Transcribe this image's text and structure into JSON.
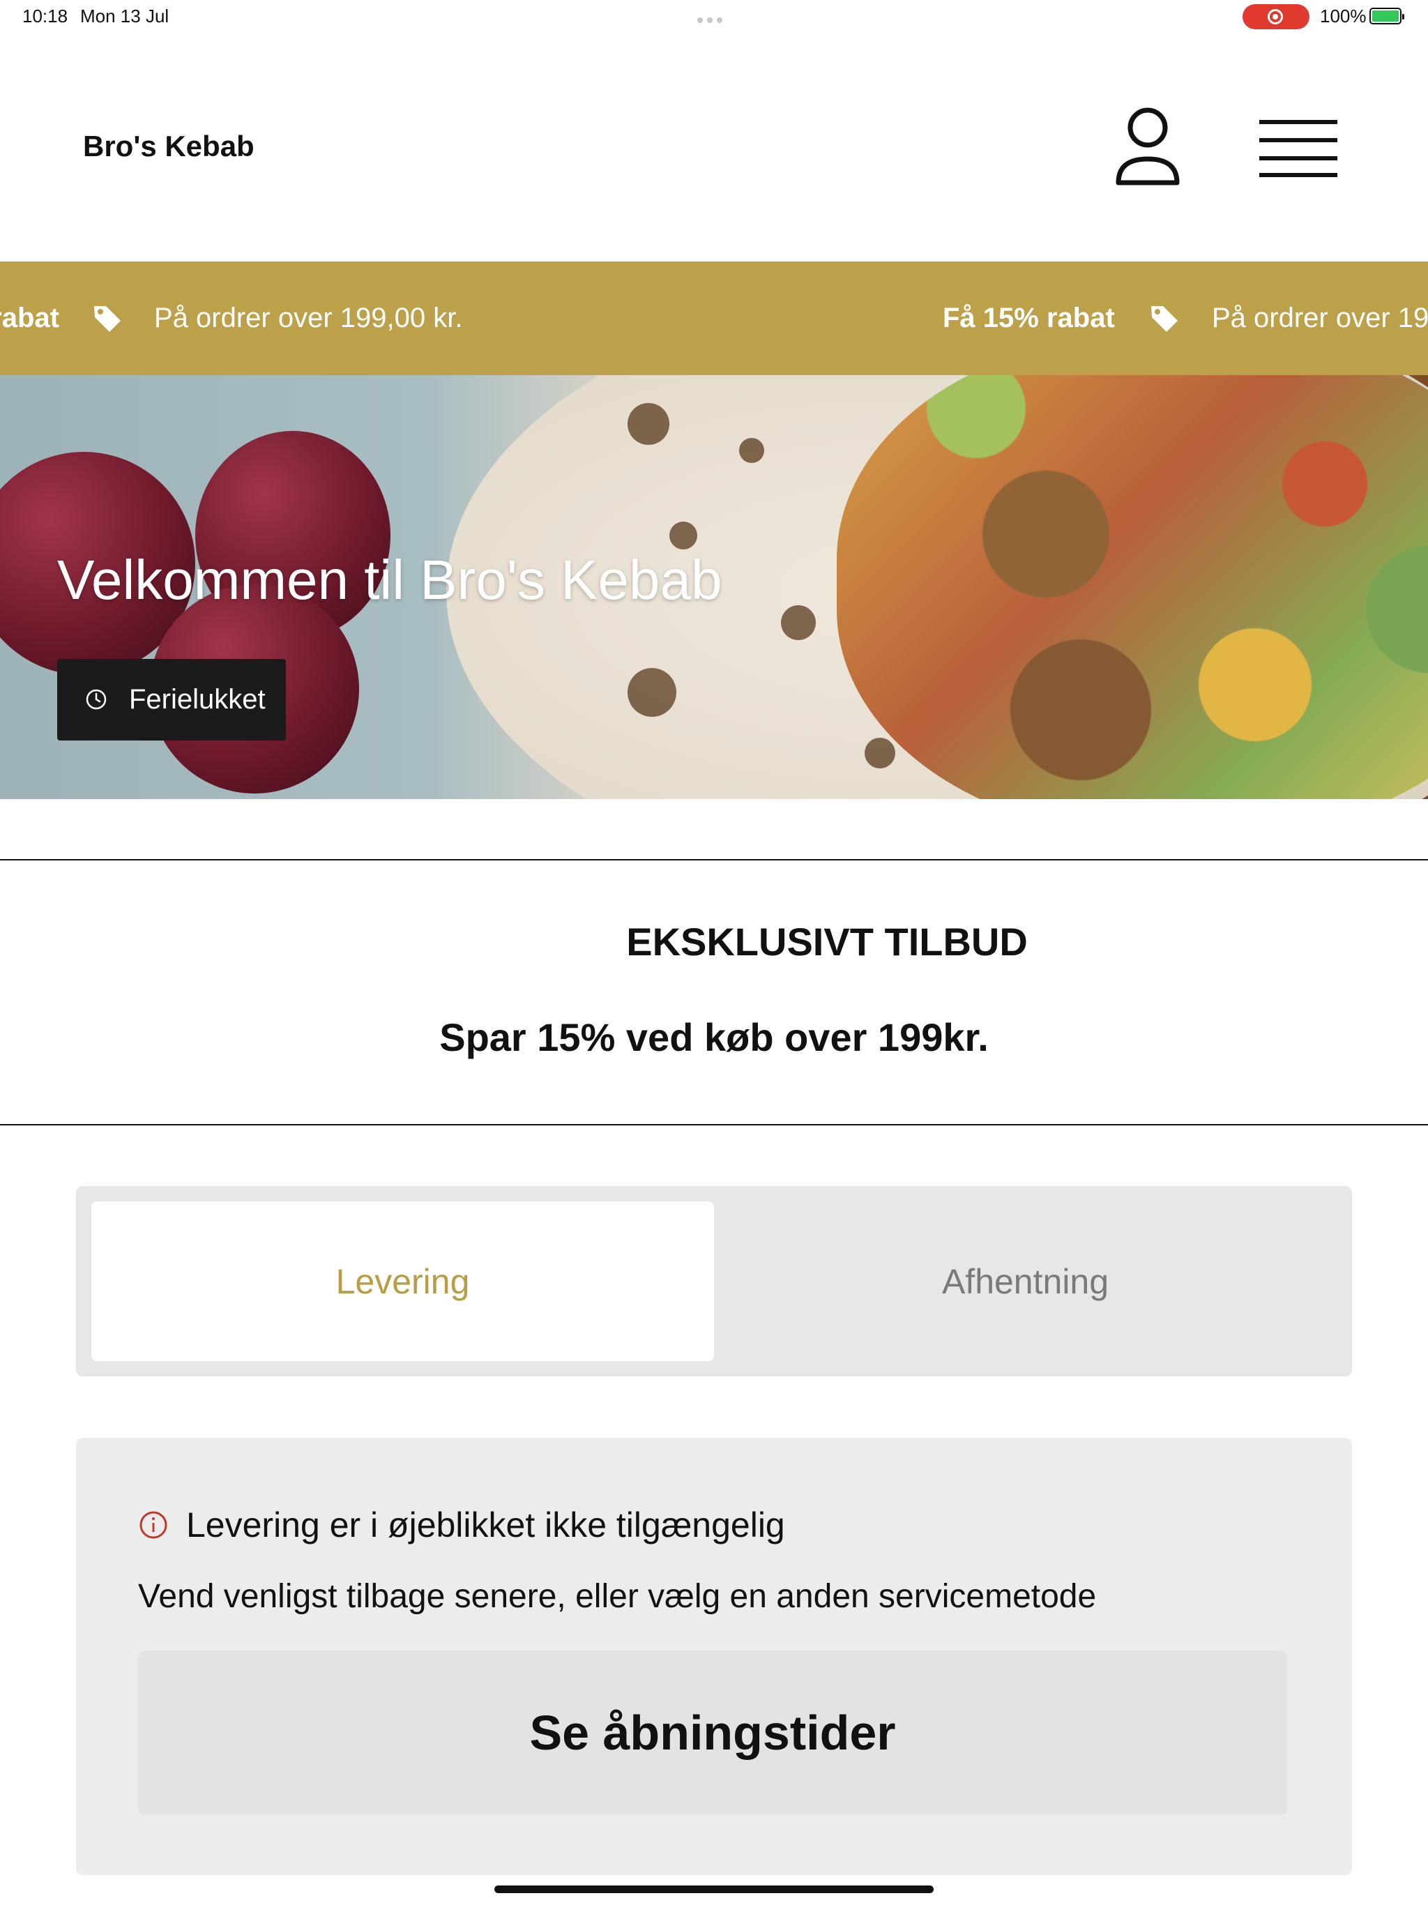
{
  "status_bar": {
    "time": "10:18",
    "date": "Mon 13 Jul",
    "battery": "100%",
    "recording_color": "#e03a2f"
  },
  "header": {
    "brand": "Bro's Kebab",
    "account_icon": "person-outline-icon",
    "menu_icon": "hamburger-menu-icon"
  },
  "promo_ticker": {
    "background": "#bda04a",
    "items": [
      {
        "title": "Få 15% rabat",
        "detail": "På ordrer over 199,00 kr."
      },
      {
        "title": "Få 15% rabat",
        "detail": "På ordrer over 199,00 kr."
      }
    ],
    "icon": "tag-icon"
  },
  "hero": {
    "title": "Velkommen til Bro's Kebab",
    "status": "Ferielukket",
    "status_icon": "clock-icon"
  },
  "offer": {
    "title": "EKSKLUSIVT TILBUD",
    "text": "Spar 15% ved køb over 199kr."
  },
  "service_tabs": [
    {
      "label": "Levering",
      "selected": true
    },
    {
      "label": "Afhentning",
      "selected": false
    }
  ],
  "accent_color": "#b89d44",
  "notice": {
    "icon": "info-circle-icon",
    "headline": "Levering er i øjeblikket ikke tilgængelig",
    "body": "Vend venligst tilbage senere, eller vælg en anden servicemetode",
    "button": "Se åbningstider"
  }
}
